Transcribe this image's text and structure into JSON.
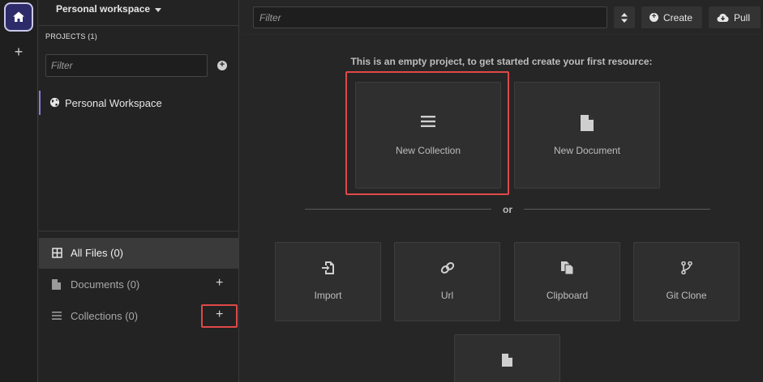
{
  "rail": {
    "home_icon": "home-icon",
    "add_label": "+"
  },
  "sidebar": {
    "workspace_title": "Personal workspace",
    "projects_label": "PROJECTS (1)",
    "filter_placeholder": "Filter",
    "project_name": "Personal Workspace",
    "nav": [
      {
        "label": "All Files (0)",
        "icon": "grid-icon",
        "active": true
      },
      {
        "label": "Documents (0)",
        "icon": "document-icon",
        "add": "+"
      },
      {
        "label": "Collections (0)",
        "icon": "list-icon",
        "add": "+"
      }
    ]
  },
  "toolbar": {
    "filter_placeholder": "Filter",
    "create_label": "Create",
    "pull_label": "Pull"
  },
  "main": {
    "empty_message": "This is an empty project, to get started create your first resource:",
    "primary_cards": [
      {
        "label": "New Collection",
        "icon": "list-icon"
      },
      {
        "label": "New Document",
        "icon": "document-icon"
      }
    ],
    "or_label": "or",
    "import_cards": [
      {
        "label": "Import",
        "icon": "import-icon"
      },
      {
        "label": "Url",
        "icon": "link-icon"
      },
      {
        "label": "Clipboard",
        "icon": "clipboard-icon"
      },
      {
        "label": "Git Clone",
        "icon": "git-branch-icon"
      }
    ]
  },
  "colors": {
    "accent": "#8b7bd8",
    "highlight": "#e04848",
    "home_bg": "#2e2b6b"
  }
}
